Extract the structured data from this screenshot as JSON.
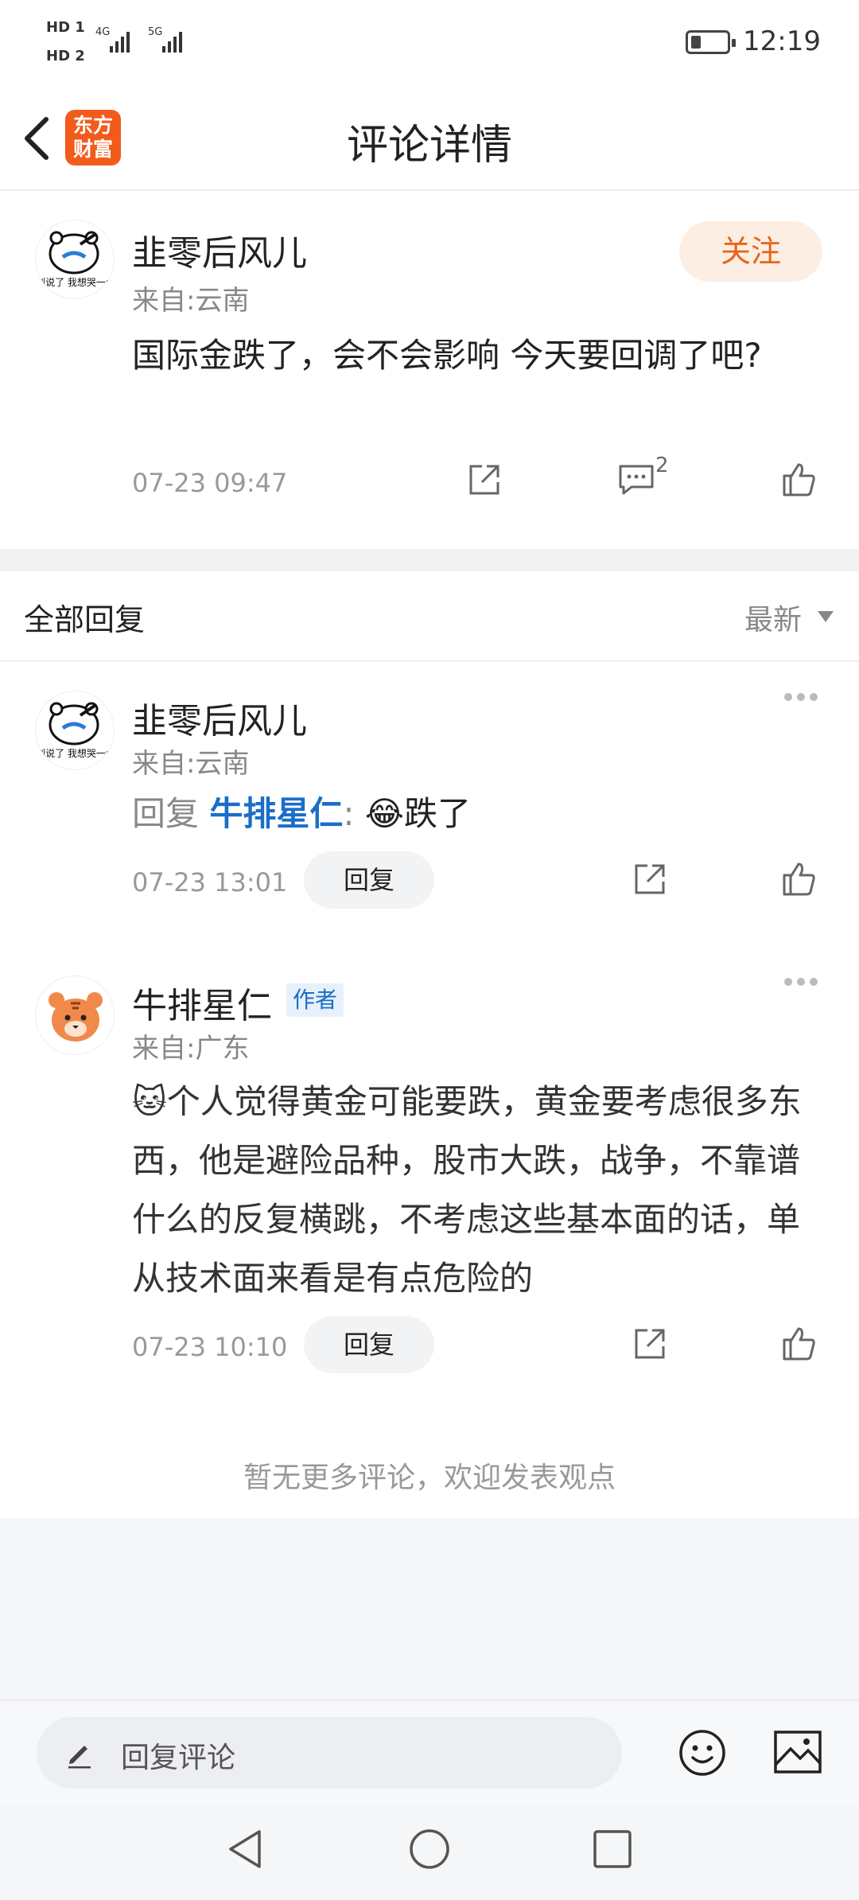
{
  "status_bar": {
    "sim1": "HD 1",
    "sim2": "HD 2",
    "net1": "4G",
    "net2": "5G",
    "time": "12:19"
  },
  "nav": {
    "title": "评论详情",
    "logo_line1": "东方",
    "logo_line2": "财富"
  },
  "main_comment": {
    "username": "韭零后风儿",
    "origin": "来自:云南",
    "follow_label": "关注",
    "text": "国际金跌了，会不会影响  今天要回调了吧?",
    "timestamp": "07-23 09:47",
    "comment_count": "2",
    "avatar_caption": "别说了 我想哭一会"
  },
  "replies": {
    "header_label": "全部回复",
    "sort_label": "最新",
    "items": [
      {
        "username": "韭零后风儿",
        "origin": "来自:云南",
        "reply_prefix": "回复",
        "mention": "牛排星仁",
        "separator": ":",
        "text": "跌了",
        "emoji": "😂",
        "timestamp": "07-23 13:01",
        "reply_button": "回复"
      },
      {
        "username": "牛排星仁",
        "badge": "作者",
        "origin": "来自:广东",
        "emoji": "🐱",
        "text": "个人觉得黄金可能要跌，黄金要考虑很多东西，他是避险品种，股市大跌，战争，不靠谱什么的反复横跳，不考虑这些基本面的话，单从技术面来看是有点危险的",
        "timestamp": "07-23 10:10",
        "reply_button": "回复"
      }
    ],
    "footer": "暂无更多评论，欢迎发表观点"
  },
  "bottom_bar": {
    "input_placeholder": "回复评论"
  },
  "icons": {
    "back": "back-icon",
    "share": "share-icon",
    "comment": "comment-icon",
    "like": "thumbs-up-icon",
    "more": "more-icon",
    "pencil": "pencil-icon",
    "emoji": "emoji-icon",
    "image": "image-icon"
  },
  "colors": {
    "accent_orange": "#e8641a",
    "mention_blue": "#1a6ec8",
    "logo_orange": "#f25b1b"
  }
}
